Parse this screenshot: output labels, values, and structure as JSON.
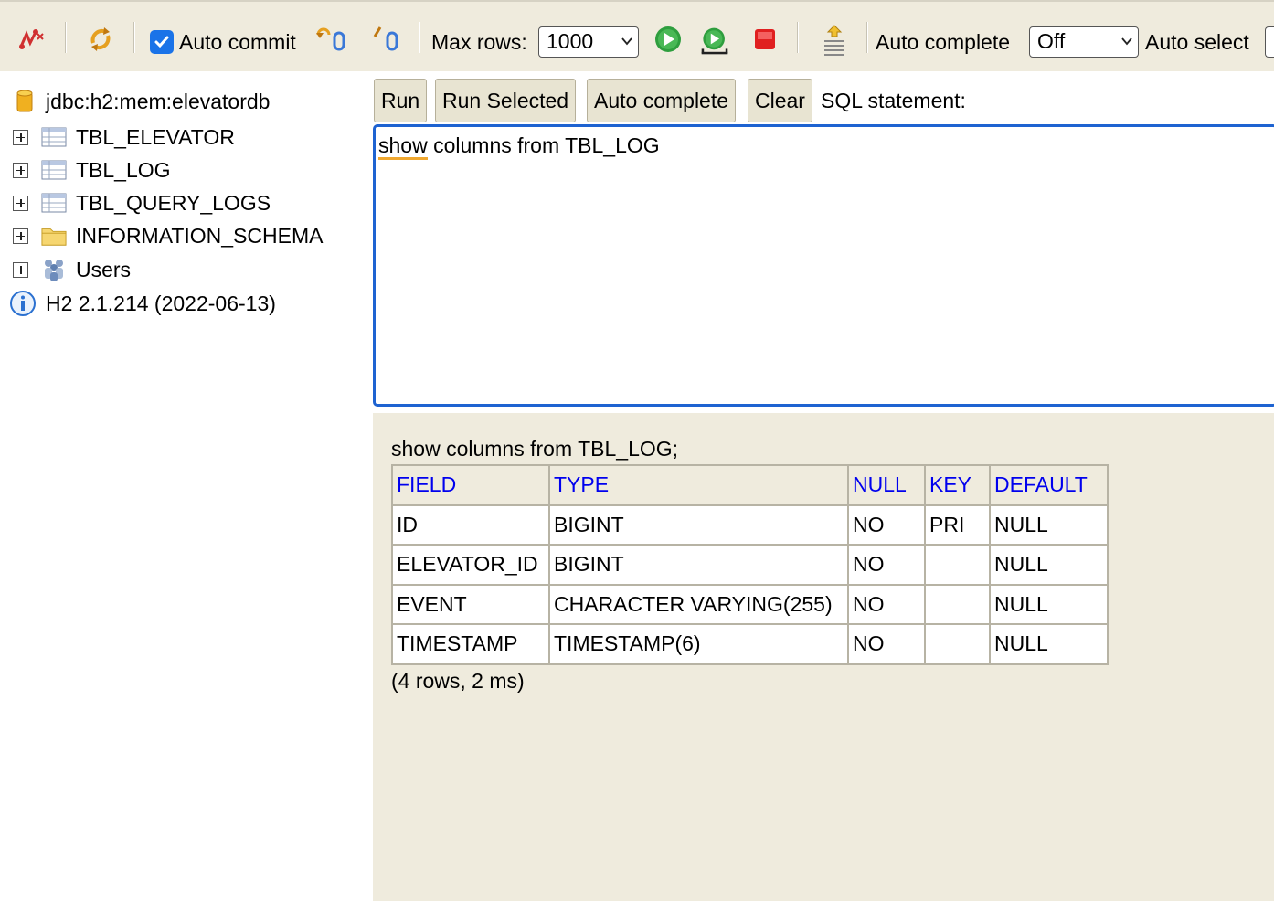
{
  "toolbar": {
    "icons": [
      "disconnect-icon",
      "refresh-icon",
      "rollback-icon",
      "commit-icon",
      "run-icon",
      "run-step-icon",
      "stop-icon",
      "history-icon"
    ],
    "auto_commit_label": "Auto commit",
    "auto_commit_checked": true,
    "max_rows_label": "Max rows:",
    "max_rows_value": "1000",
    "auto_complete_label": "Auto complete",
    "auto_complete_value": "Off",
    "auto_select_label": "Auto select"
  },
  "tree": {
    "connection": "jdbc:h2:mem:elevatordb",
    "items": [
      {
        "label": "TBL_ELEVATOR",
        "icon": "table-icon"
      },
      {
        "label": "TBL_LOG",
        "icon": "table-icon"
      },
      {
        "label": "TBL_QUERY_LOGS",
        "icon": "table-icon"
      },
      {
        "label": "INFORMATION_SCHEMA",
        "icon": "folder-icon"
      },
      {
        "label": "Users",
        "icon": "users-icon"
      }
    ],
    "version": "H2 2.1.214 (2022-06-13)"
  },
  "query": {
    "buttons": {
      "run": "Run",
      "run_selected": "Run Selected",
      "auto_complete": "Auto complete",
      "clear": "Clear"
    },
    "sql_label": "SQL statement:",
    "editor_word1": "show",
    "editor_rest": " columns from TBL_LOG"
  },
  "result": {
    "statement": "show columns from TBL_LOG;",
    "columns": [
      "FIELD",
      "TYPE",
      "NULL",
      "KEY",
      "DEFAULT"
    ],
    "rows": [
      [
        "ID",
        "BIGINT",
        "NO",
        "PRI",
        "NULL"
      ],
      [
        "ELEVATOR_ID",
        "BIGINT",
        "NO",
        "",
        "NULL"
      ],
      [
        "EVENT",
        "CHARACTER VARYING(255)",
        "NO",
        "",
        "NULL"
      ],
      [
        "TIMESTAMP",
        "TIMESTAMP(6)",
        "NO",
        "",
        "NULL"
      ]
    ],
    "footer": "(4 rows, 2 ms)"
  },
  "colors": {
    "toolbar_bg": "#efebdd",
    "header_link": "#0000ee",
    "editor_border": "#1e63d1",
    "run_green": "#2e9e3e",
    "stop_red": "#e02020"
  }
}
